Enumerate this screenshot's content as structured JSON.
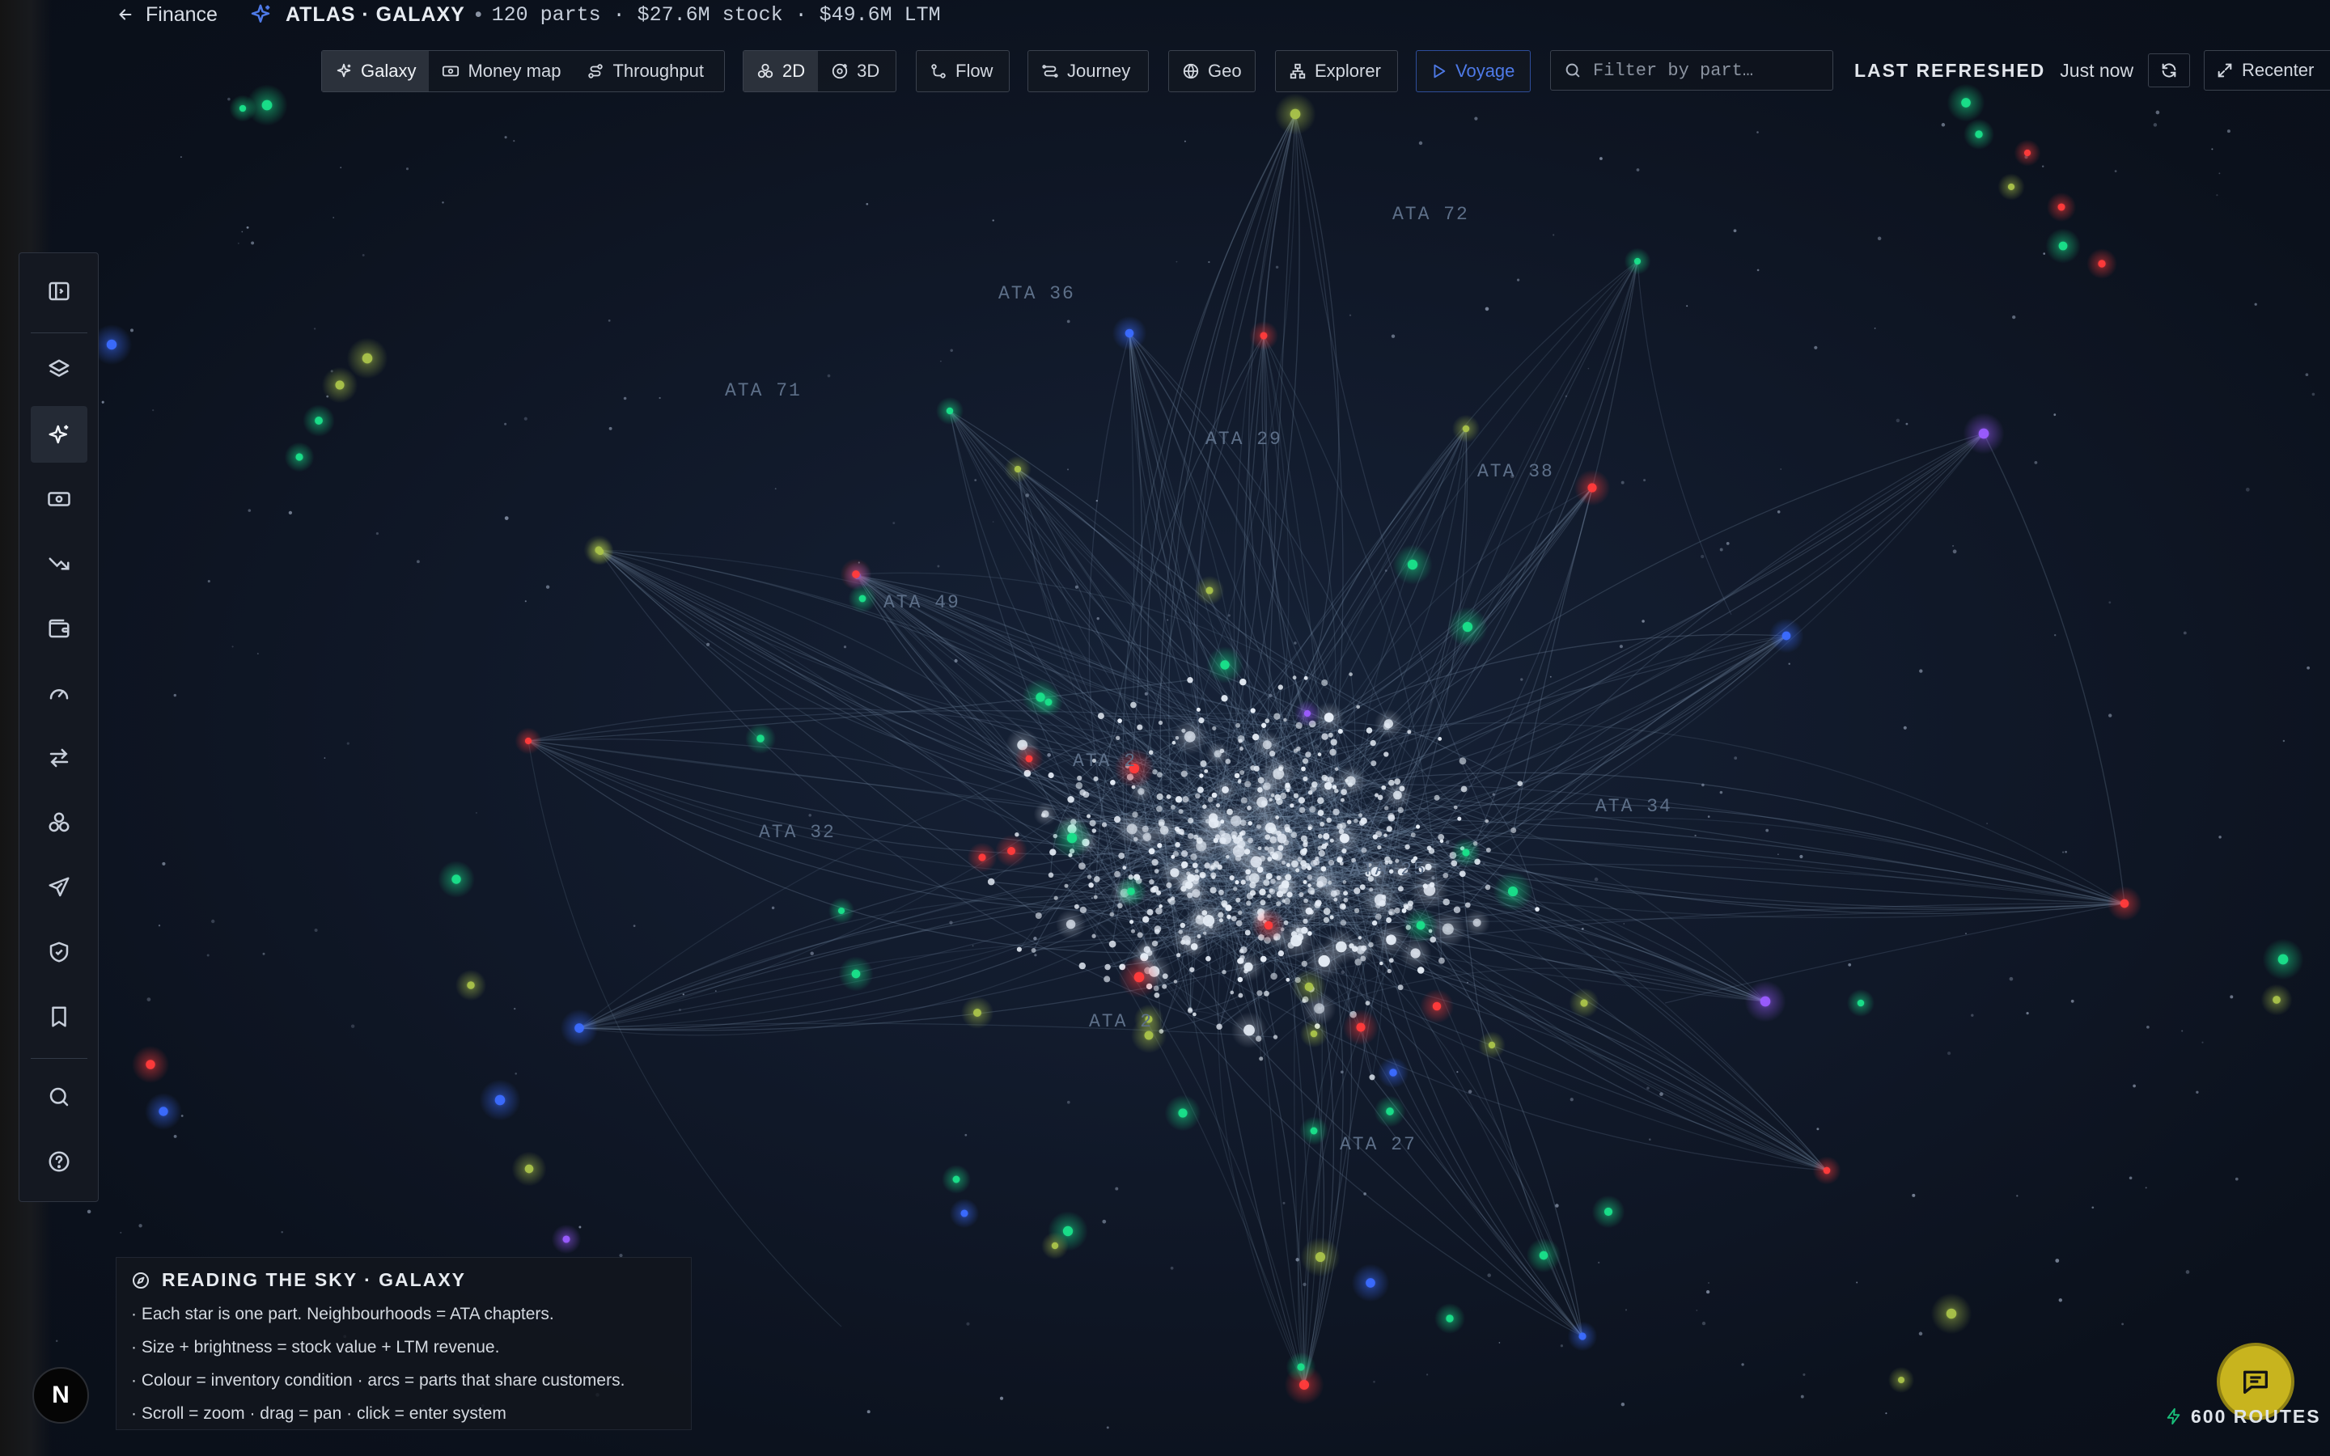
{
  "breadcrumb": {
    "back_label": "Finance",
    "title": "ATLAS · GALAXY",
    "stats": "120 parts · $27.6M stock · $49.6M LTM"
  },
  "toolbar": {
    "view_tabs": [
      {
        "label": "Galaxy",
        "icon": "sparkle-icon",
        "active": true
      },
      {
        "label": "Money map",
        "icon": "banknote-icon",
        "active": false
      },
      {
        "label": "Throughput",
        "icon": "route-icon",
        "active": false
      }
    ],
    "dimension_tabs": [
      {
        "label": "2D",
        "icon": "cluster-icon",
        "active": true
      },
      {
        "label": "3D",
        "icon": "orbit-icon",
        "active": false
      }
    ],
    "flow_label": "Flow",
    "journey_label": "Journey",
    "geo_label": "Geo",
    "explorer_label": "Explorer",
    "voyage_label": "Voyage",
    "accent_color": "#4e7ae8"
  },
  "search": {
    "placeholder": "Filter by part…"
  },
  "refresh": {
    "label": "LAST REFRESHED",
    "value": "Just now"
  },
  "recenter_label": "Recenter",
  "rail": {
    "items": [
      {
        "name": "sidebar-toggle-icon"
      },
      {
        "name": "layers-icon"
      },
      {
        "name": "sparkle-icon",
        "active": true
      },
      {
        "name": "banknote-icon"
      },
      {
        "name": "trend-down-icon"
      },
      {
        "name": "wallet-icon"
      },
      {
        "name": "gauge-icon"
      },
      {
        "name": "swap-arrows-icon"
      },
      {
        "name": "cluster-icon"
      },
      {
        "name": "plane-icon"
      },
      {
        "name": "shield-check-icon"
      },
      {
        "name": "bookmark-icon"
      },
      {
        "name": "search-icon"
      },
      {
        "name": "help-icon"
      }
    ]
  },
  "ata_labels": [
    "ATA 72",
    "ATA 36",
    "ATA 71",
    "ATA 29",
    "ATA 38",
    "ATA 49",
    "ATA 2",
    "ATA 34",
    "ATA 32",
    "ATA 25",
    "ATA 2",
    "ATA 27"
  ],
  "legend": {
    "title": "READING THE SKY · GALAXY",
    "lines": [
      "· Each star is one part. Neighbourhoods = ATA chapters.",
      "· Size + brightness = stock value + LTM revenue.",
      "· Colour = inventory condition · arcs = parts that share customers.",
      "· Scroll = zoom · drag = pan · click = enter system"
    ]
  },
  "avatar_letter": "N",
  "routes_label": "600 ROUTES",
  "colors": {
    "background": "#0b101a",
    "star_white": "#e6edf6",
    "condition_red": "#ff3b3b",
    "condition_green": "#19e08a",
    "condition_blue": "#3b6cff",
    "condition_purple": "#9b5cff",
    "condition_olive": "#a9c24a",
    "arc_color": "#7c93ad",
    "chat_button": "#c8b41e"
  }
}
